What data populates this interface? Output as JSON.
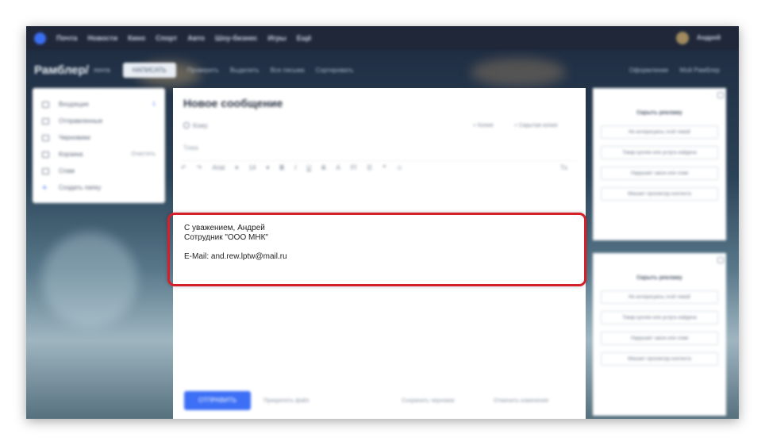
{
  "topbar": {
    "items": [
      "Почта",
      "Новости",
      "Кино",
      "Спорт",
      "Авто",
      "Шоу-бизнес",
      "Игры",
      "Ещё"
    ],
    "user": "Андрей"
  },
  "header": {
    "logo": "Рамблер/",
    "logo_sub": "почта",
    "write_button": "НАПИСАТЬ",
    "items": [
      "Проверить",
      "Выделить",
      "Все письма",
      "Сортировать",
      "Оформление",
      "Мой Рамблер"
    ]
  },
  "sidebar": {
    "items": [
      {
        "label": "Входящие",
        "count": "1",
        "extra": "",
        "icon": "inbox-icon"
      },
      {
        "label": "Отправленные",
        "count": "",
        "extra": "",
        "icon": "send-icon"
      },
      {
        "label": "Черновики",
        "count": "",
        "extra": "",
        "icon": "draft-icon"
      },
      {
        "label": "Корзина",
        "count": "",
        "extra": "Очистить",
        "icon": "trash-icon"
      },
      {
        "label": "Спам",
        "count": "",
        "extra": "",
        "icon": "spam-icon"
      },
      {
        "label": "Создать папку",
        "count": "",
        "extra": "",
        "icon": "plus-icon"
      }
    ]
  },
  "compose": {
    "title": "Новое сообщение",
    "to_label": "Кому",
    "copy_label": "+ Копия",
    "hidden_copy_label": "+ Скрытая копия",
    "subject_label": "Тема",
    "toolbar": [
      "↶",
      "↷",
      "Arial",
      "▾",
      "14",
      "▾",
      "B",
      "I",
      "U",
      "S",
      "A",
      "Ff",
      "☰",
      "❝",
      "☺"
    ],
    "toolbar_right": "Tx",
    "signature": {
      "line1": "С уважением, Андрей",
      "line2": "Сотрудник \"ООО МНК\"",
      "line3": "E-Mail: and.rew.lptw@mail.ru"
    },
    "send_button": "ОТПРАВИТЬ",
    "attach_label": "Прикрепить файл",
    "save_draft_label": "Сохранить черновик",
    "cancel_label": "Отменить изменения"
  },
  "ads": [
    {
      "title": "Скрыть рекламу",
      "options": [
        "Не интересуюсь этой темой",
        "Товар куплен или услуга найдена",
        "Нарушает закон или спам",
        "Мешает просмотру контента"
      ]
    },
    {
      "title": "Скрыть рекламу",
      "options": [
        "Не интересуюсь этой темой",
        "Товар куплен или услуга найдена",
        "Нарушает закон или спам",
        "Мешает просмотру контента"
      ]
    }
  ],
  "colors": {
    "accent": "#3c6ff5",
    "highlight": "#d5202a",
    "topbar": "#1f2739"
  }
}
